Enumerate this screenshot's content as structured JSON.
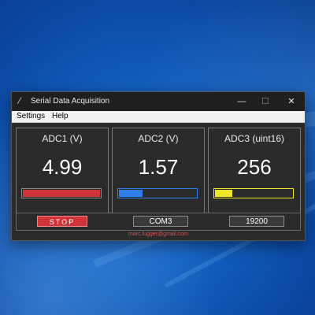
{
  "window": {
    "title": "Serial Data Acquisition",
    "controls": {
      "minimize": "—",
      "maximize": "☐",
      "close": "✕"
    }
  },
  "menu": {
    "items": [
      "Settings",
      "Help"
    ]
  },
  "panels": [
    {
      "label": "ADC1 (V)",
      "value": "4.99",
      "bar_fraction": 1.0,
      "bar_color": "#d13438"
    },
    {
      "label": "ADC2 (V)",
      "value": "1.57",
      "bar_fraction": 0.31,
      "bar_color": "#2f80ed"
    },
    {
      "label": "ADC3 (uint16)",
      "value": "256",
      "bar_fraction": 0.22,
      "bar_color": "#f0e62a"
    }
  ],
  "controls": {
    "stop_label": "STOP",
    "port_value": "COM3",
    "baud_value": "19200"
  },
  "footer": {
    "email": "marc.lugger@gmail.com"
  },
  "colors": {
    "stop": "#d13438",
    "footer_text": "#d9534f"
  },
  "icons": [
    "app-icon",
    "minimize-icon",
    "maximize-icon",
    "close-icon"
  ]
}
